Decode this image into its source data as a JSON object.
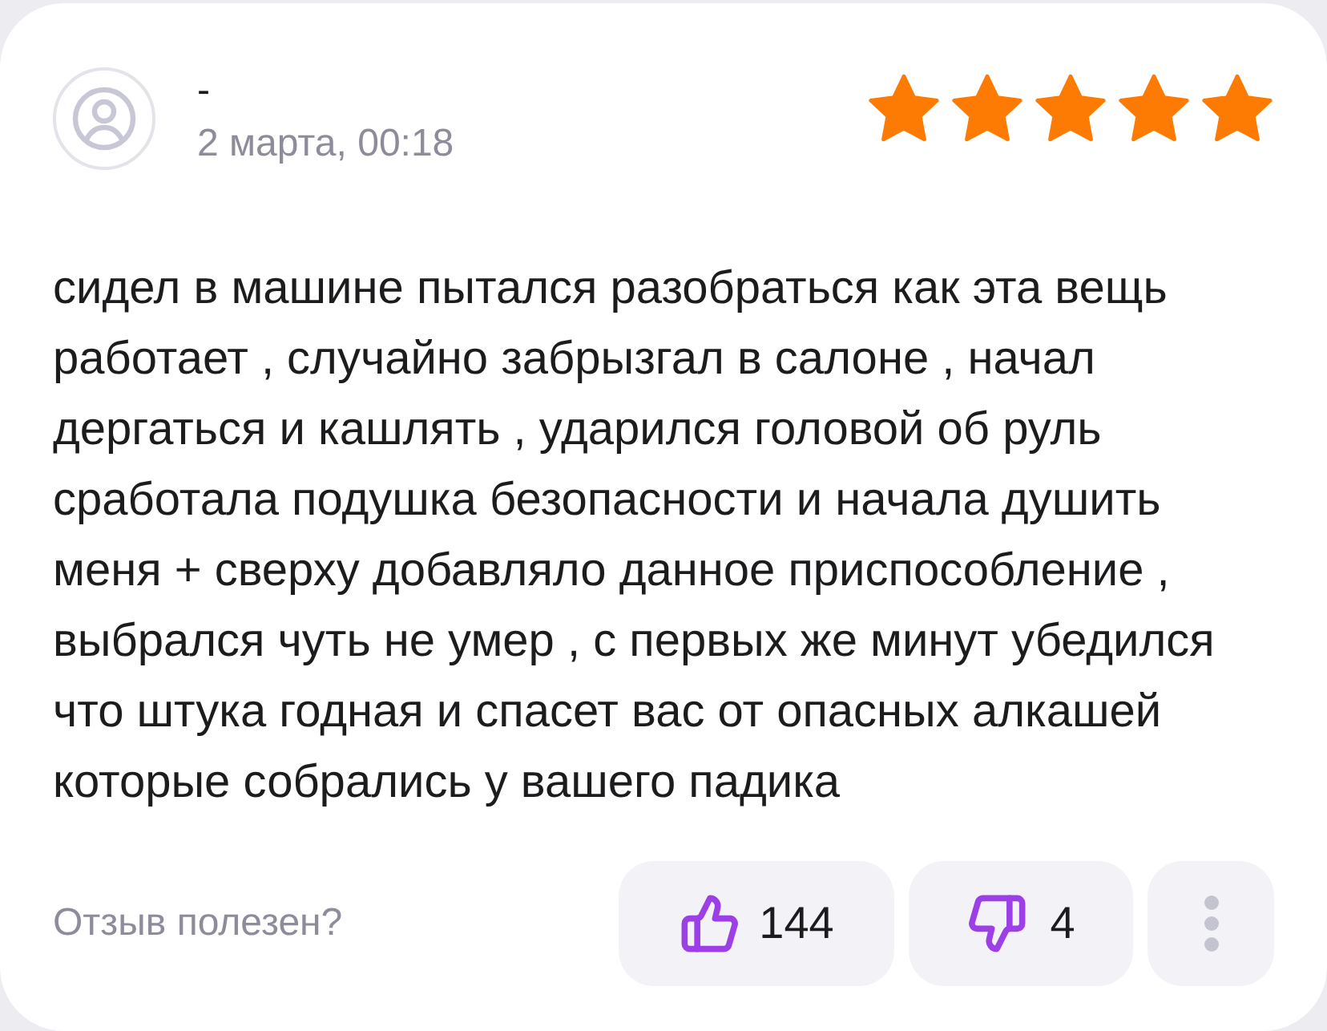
{
  "review": {
    "author": "-",
    "date": "2 марта, 00:18",
    "stars": 5,
    "text": "сидел в машине пытался разобраться как эта вещь работает , случайно забрызгал в салоне , начал дергаться и кашлять , ударился головой об руль сработала подушка безопасности и начала душить меня + сверху добавляло данное приспособление , выбрался чуть не умер , с первых же минут убедился что штука годная и спасет вас от опасных алкашей которые собрались у вашего падика",
    "helpful_prompt": "Отзыв полезен?",
    "likes": "144",
    "dislikes": "4"
  }
}
